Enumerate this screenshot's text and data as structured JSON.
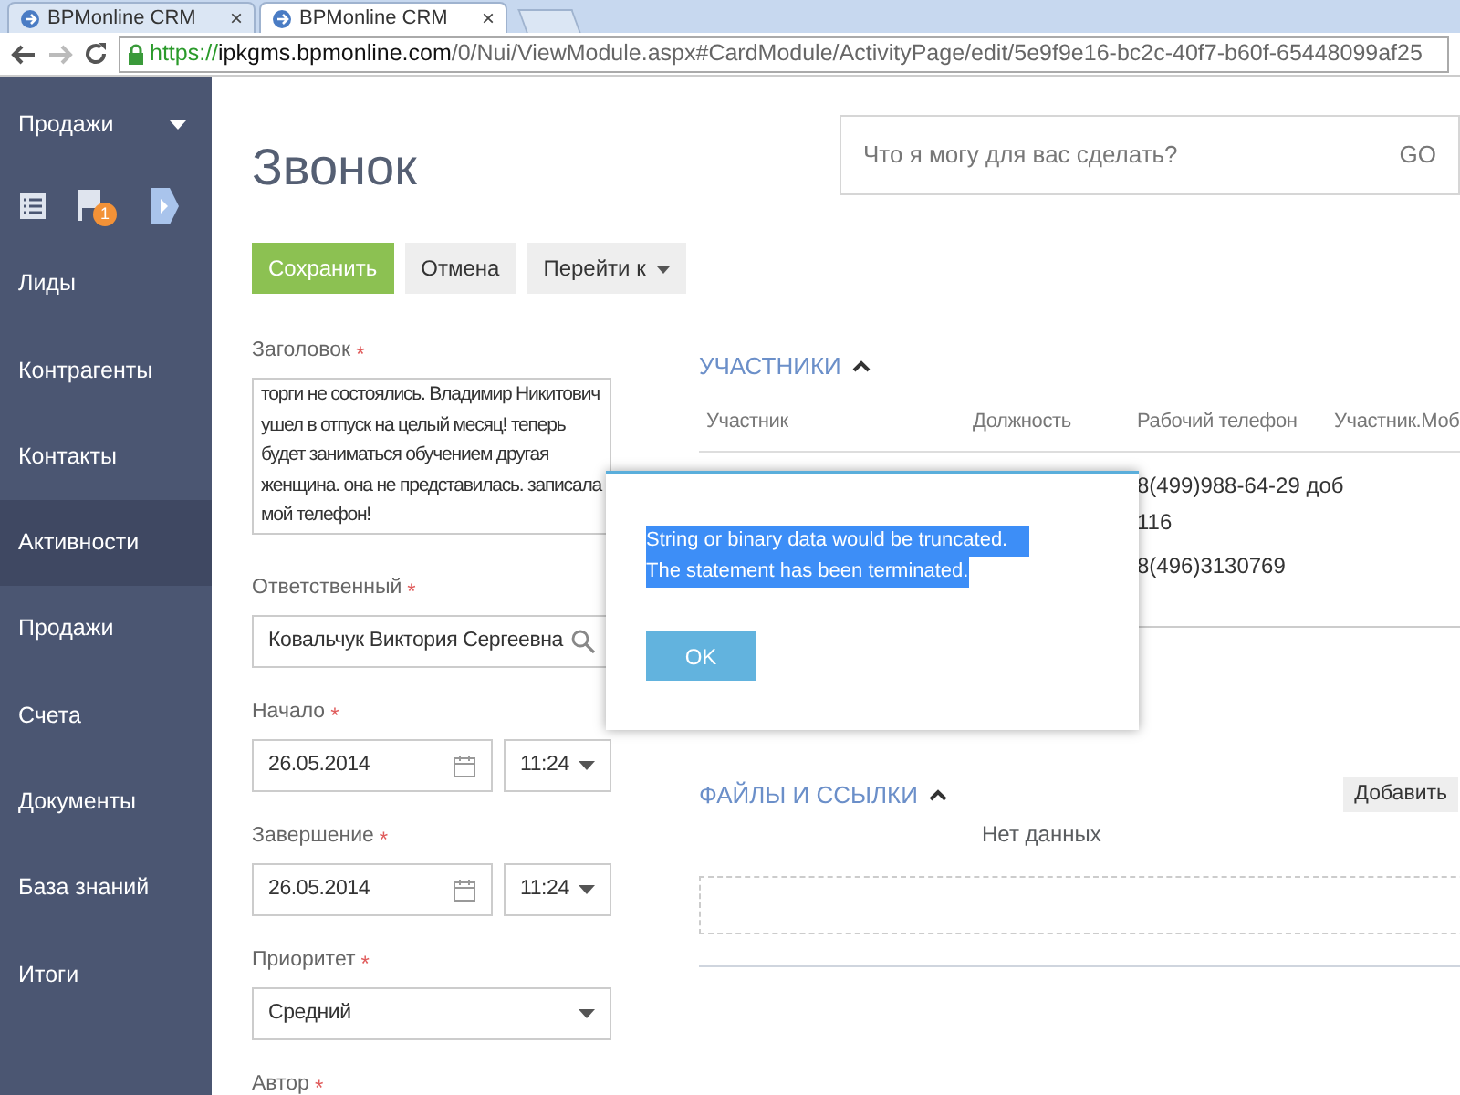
{
  "browser": {
    "tabs": [
      {
        "title": "BPMonline CRM",
        "selected": false
      },
      {
        "title": "BPMonline CRM",
        "selected": true
      }
    ],
    "close_glyph": "×",
    "url": {
      "scheme": "https://",
      "host": "ipkgms.bpmonline.com",
      "path": "/0/Nui/ViewModule.aspx#CardModule/ActivityPage/edit/5e9f9e16-bc2c-40f7-b60f-65448099af25"
    }
  },
  "sidebar": {
    "section": "Продажи",
    "badge": "1",
    "items": [
      {
        "label": "Лиды",
        "selected": false
      },
      {
        "label": "Контрагенты",
        "selected": false
      },
      {
        "label": "Контакты",
        "selected": false
      },
      {
        "label": "Активности",
        "selected": true
      },
      {
        "label": "Продажи",
        "selected": false
      },
      {
        "label": "Счета",
        "selected": false
      },
      {
        "label": "Документы",
        "selected": false
      },
      {
        "label": "База знаний",
        "selected": false
      },
      {
        "label": "Итоги",
        "selected": false
      }
    ]
  },
  "page": {
    "title": "Звонок",
    "search": {
      "placeholder": "Что я могу для вас сделать?",
      "go": "GO"
    }
  },
  "buttons": [
    {
      "label": "Сохранить",
      "kind": "primary"
    },
    {
      "label": "Отмена",
      "kind": "plain"
    },
    {
      "label": "Перейти к",
      "kind": "menu"
    }
  ],
  "required_mark": "*",
  "fields": [
    {
      "label": "Заголовок",
      "required": true,
      "kind": "textarea",
      "value": "торги не состоялись. Владимир Никитович ушел в отпуск на целый месяц! теперь будет заниматься обучением другая женщина. она не представилась. записала мой телефон!"
    },
    {
      "label": "Ответственный",
      "required": true,
      "kind": "lookup",
      "value": "Ковальчук Виктория Сергеевна"
    },
    {
      "label": "Начало",
      "required": true,
      "kind": "datetime",
      "value": "26.05.2014",
      "time": "11:24"
    },
    {
      "label": "Завершение",
      "required": true,
      "kind": "datetime",
      "value": "26.05.2014",
      "time": "11:24"
    },
    {
      "label": "Приоритет",
      "required": true,
      "kind": "select",
      "value": "Средний"
    },
    {
      "label": "Автор",
      "required": true,
      "kind": "label"
    }
  ],
  "participants": {
    "title": "УЧАСТНИКИ",
    "expanded": true,
    "columns": [
      "Участник",
      "Должность",
      "Рабочий телефон",
      "Участник.Моб"
    ],
    "rows": [
      {
        "work_phone": "8(499)988-64-29 доб 116"
      },
      {
        "work_phone": "8(496)3130769"
      }
    ]
  },
  "files": {
    "title": "ФАЙЛЫ И ССЫЛКИ",
    "expanded": true,
    "add": "Добавить",
    "empty": "Нет данных"
  },
  "dialog": {
    "lines": [
      "String or binary data would be truncated.",
      "The statement has been terminated."
    ],
    "highlighted": true,
    "button": "OK"
  }
}
